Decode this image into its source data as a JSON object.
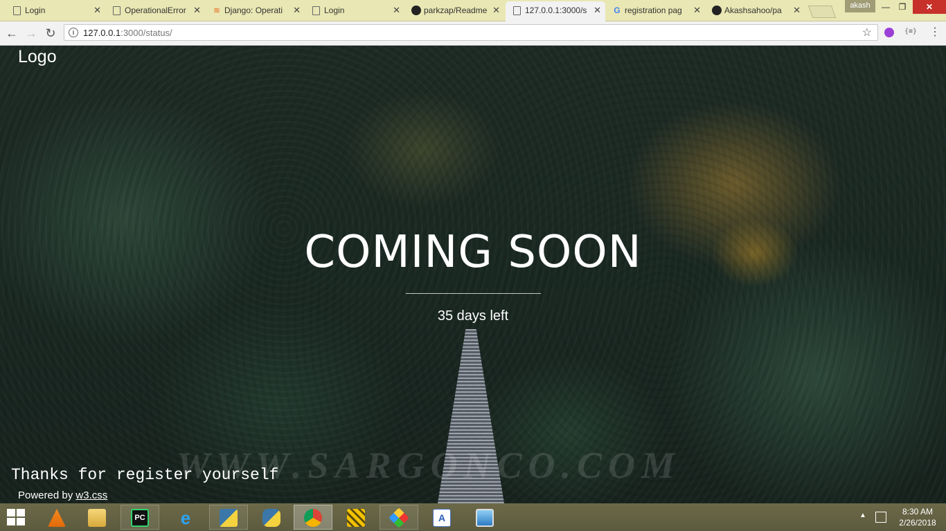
{
  "browser": {
    "tabs": [
      {
        "label": "Login",
        "icon": "document-icon"
      },
      {
        "label": "OperationalError",
        "icon": "document-icon"
      },
      {
        "label": "Django: Operati",
        "icon": "stackoverflow-icon"
      },
      {
        "label": "Login",
        "icon": "document-icon"
      },
      {
        "label": "parkzap/Readme",
        "icon": "github-icon"
      },
      {
        "label": "127.0.0.1:3000/s",
        "icon": "document-icon"
      },
      {
        "label": "registration pag",
        "icon": "google-icon"
      },
      {
        "label": "Akashsahoo/pa",
        "icon": "github-icon"
      }
    ],
    "active_tab": 5,
    "user_badge": "akash",
    "url_host": "127.0.0.1",
    "url_path": ":3000/status/",
    "extension_label": "{≡}"
  },
  "page": {
    "logo": "Logo",
    "headline": "COMING SOON",
    "countdown": "35 days left",
    "watermark": "WWW.SARGONCO.COM",
    "thanks": "Thanks for register yourself",
    "powered_prefix": "Powered by ",
    "powered_link": "w3.css"
  },
  "taskbar": {
    "apps": [
      "vlc",
      "file-explorer",
      "pycharm",
      "internet-explorer",
      "python-file",
      "python-idle",
      "chrome",
      "app-yellow",
      "app-tiles",
      "app-editor",
      "app-photos"
    ],
    "time": "8:30 AM",
    "date": "2/26/2018"
  },
  "colors": {
    "chrome_frame": "#e9e7b3",
    "taskbar": "#5d5b3f",
    "text": "#ffffff",
    "close_button": "#c7312a"
  }
}
